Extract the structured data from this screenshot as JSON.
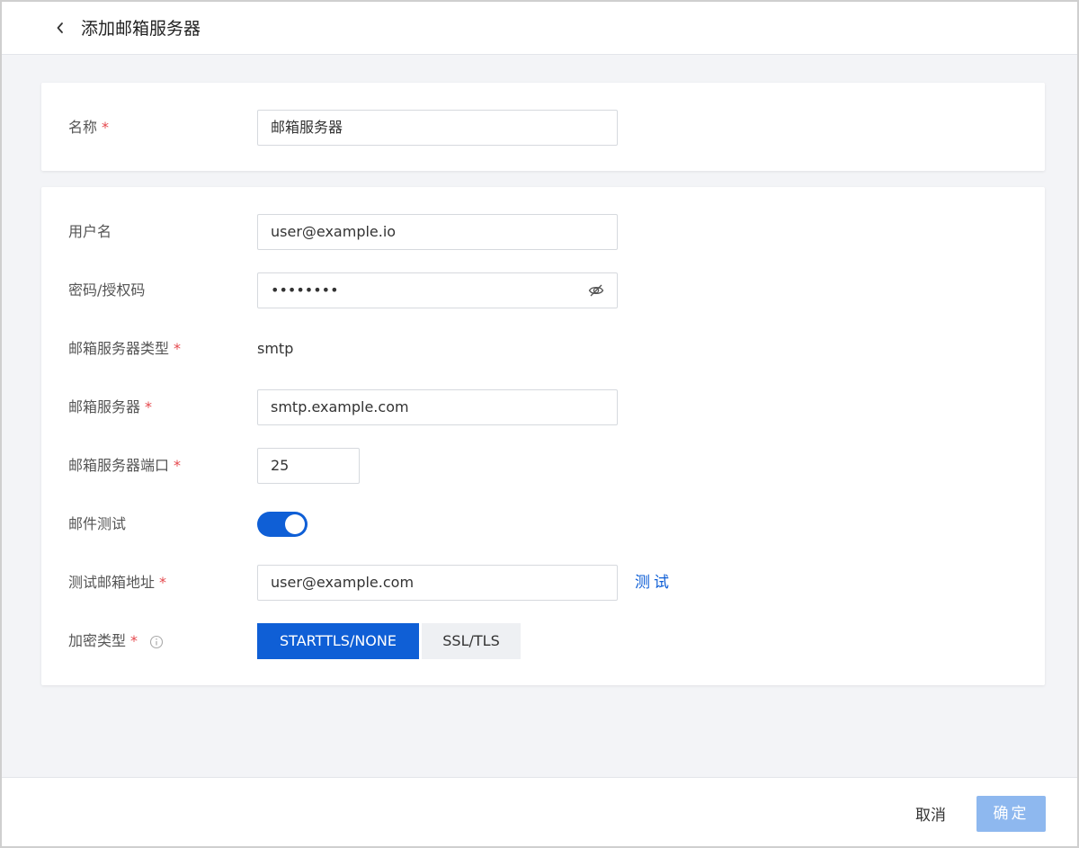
{
  "header": {
    "title": "添加邮箱服务器",
    "back_icon": "chevron-left-icon"
  },
  "form": {
    "name": {
      "label": "名称",
      "required": "*",
      "value": "邮箱服务器"
    },
    "username": {
      "label": "用户名",
      "value": "user@example.io"
    },
    "password": {
      "label": "密码/授权码",
      "value": "••••••••",
      "toggle_icon": "eye-off-icon"
    },
    "server_type": {
      "label": "邮箱服务器类型",
      "required": "*",
      "value": "smtp"
    },
    "server": {
      "label": "邮箱服务器",
      "required": "*",
      "value": "smtp.example.com"
    },
    "port": {
      "label": "邮箱服务器端口",
      "required": "*",
      "value": "25"
    },
    "mail_test": {
      "label": "邮件测试",
      "enabled": true
    },
    "test_address": {
      "label": "测试邮箱地址",
      "required": "*",
      "value": "user@example.com",
      "test_label": "测试"
    },
    "encryption": {
      "label": "加密类型",
      "required": "*",
      "info_icon": "info-icon",
      "options": [
        "STARTTLS/NONE",
        "SSL/TLS"
      ],
      "selected": "STARTTLS/NONE"
    }
  },
  "footer": {
    "cancel_label": "取消",
    "ok_label": "确定"
  },
  "colors": {
    "primary": "#0f5fd6",
    "disabled_primary": "#8eb8ef",
    "required": "#e5484d",
    "background": "#f3f4f7"
  }
}
